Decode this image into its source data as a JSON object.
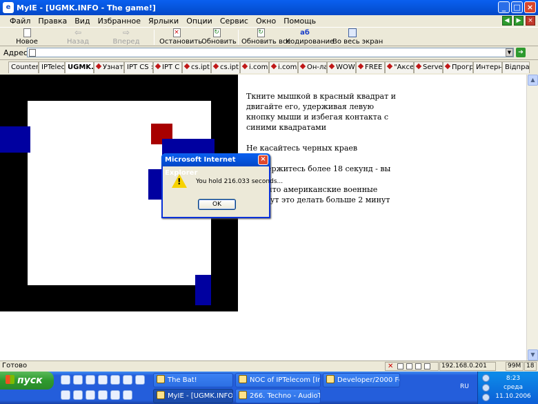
{
  "window": {
    "title": "MyIE - [UGMK.INFO - The game!]",
    "app_icon": "myie-icon"
  },
  "menu": [
    "Файл",
    "Правка",
    "Вид",
    "Избранное",
    "Ярлыки",
    "Опции",
    "Сервис",
    "Окно",
    "Помощь"
  ],
  "toolbar": {
    "new": "Новое",
    "back": "Назад",
    "forward": "Вперед",
    "stop": "Остановить",
    "refresh": "Обновить",
    "refresh_all": "Обновить все",
    "encoding": "Кодирование",
    "fullscreen": "Во весь экран"
  },
  "address": {
    "label": "Адрес",
    "value": ""
  },
  "tabs": [
    {
      "label": "Counter",
      "dot": false
    },
    {
      "label": "IPTelecom",
      "dot": false
    },
    {
      "label": "UGMK.INFO",
      "dot": false,
      "active": true
    },
    {
      "label": "Узнать",
      "dot": true
    },
    {
      "label": "IPT CS :",
      "dot": false
    },
    {
      "label": "IPT C",
      "dot": true
    },
    {
      "label": "cs.ipt",
      "dot": true
    },
    {
      "label": "cs.ipt",
      "dot": true
    },
    {
      "label": "i.com",
      "dot": true
    },
    {
      "label": "i.com",
      "dot": true
    },
    {
      "label": "Он-ла",
      "dot": true
    },
    {
      "label": "WOW",
      "dot": true
    },
    {
      "label": "FREE",
      "dot": true
    },
    {
      "label": "\"Аксе",
      "dot": true
    },
    {
      "label": "Serve",
      "dot": true
    },
    {
      "label": "Прогр",
      "dot": true
    },
    {
      "label": "Интерне",
      "dot": false
    },
    {
      "label": "Відправ",
      "dot": false
    }
  ],
  "page": {
    "instructions": "Ткните мышкой в красный квадрат и двигайте его, удерживая левую кнопку мыши и избегая контакта с синими квадратами",
    "warning": "Не касайтесь черных краев",
    "hint_line1": "Продержитесь более 18 секунд - вы",
    "fact_line1": "...кт, что американские военные",
    "fact_line2": "... могут это делать больше 2 минут",
    "colors": {
      "border": "#000000",
      "field": "#ffffff",
      "player": "#a80000",
      "enemy": "#0000a0"
    }
  },
  "dialog": {
    "title": "Microsoft Internet Explorer",
    "message": "You hold 216.033 seconds...",
    "ok": "OK",
    "icon": "warning-icon"
  },
  "status": {
    "text": "Готово",
    "ip": "192.168.0.201",
    "memory": "99M",
    "count": "18"
  },
  "taskbar": {
    "start": "пуск",
    "buttons": [
      {
        "label": "The Bat!",
        "active": false
      },
      {
        "label": "NOC of IPTelecom [In...",
        "active": false
      },
      {
        "label": "Developer/2000 Form...",
        "active": false
      },
      {
        "label": "MyIE - [UGMK.INFO -...",
        "active": true
      },
      {
        "label": "266. Techno - AudioT...",
        "active": false
      }
    ],
    "lang": "RU",
    "time": "8:23",
    "day": "среда",
    "date": "11.10.2006"
  }
}
